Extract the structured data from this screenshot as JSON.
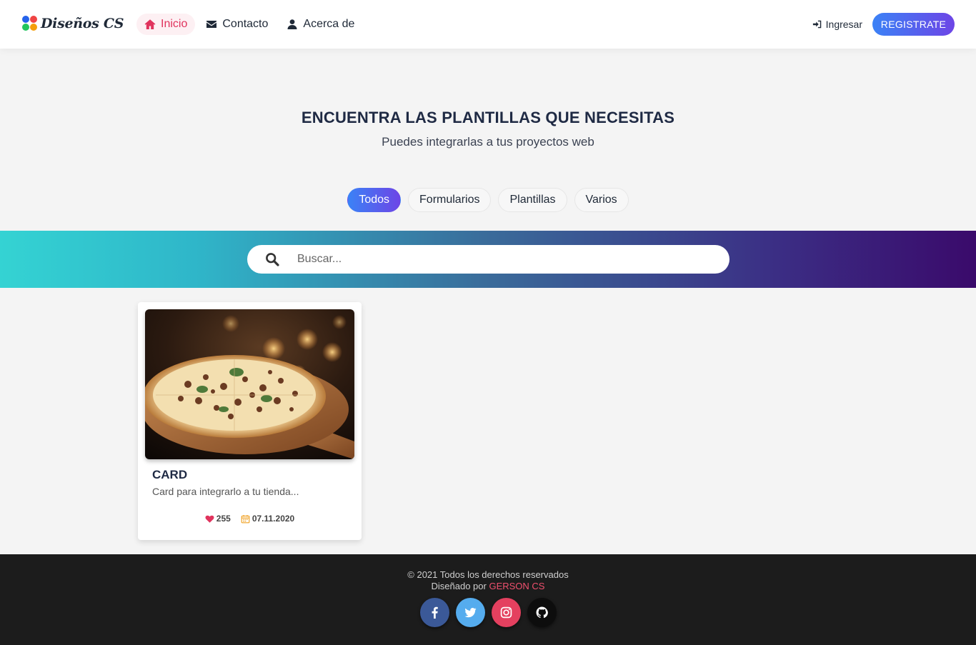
{
  "brand": {
    "name": "Diseños CS"
  },
  "nav": {
    "items": [
      {
        "label": "Inicio",
        "icon": "home-icon",
        "active": true
      },
      {
        "label": "Contacto",
        "icon": "envelope-icon",
        "active": false
      },
      {
        "label": "Acerca de",
        "icon": "user-icon",
        "active": false
      }
    ],
    "login_label": "Ingresar",
    "register_label": "REGISTRATE"
  },
  "hero": {
    "title": "ENCUENTRA LAS PLANTILLAS QUE NECESITAS",
    "subtitle": "Puedes integrarlas a tus proyectos web"
  },
  "filters": [
    {
      "label": "Todos",
      "active": true
    },
    {
      "label": "Formularios",
      "active": false
    },
    {
      "label": "Plantillas",
      "active": false
    },
    {
      "label": "Varios",
      "active": false
    }
  ],
  "search": {
    "placeholder": "Buscar...",
    "value": ""
  },
  "cards": [
    {
      "title": "CARD",
      "description": "Card para integrarlo a tu tienda...",
      "likes": "255",
      "date": "07.11.2020",
      "image": "pizza-image"
    }
  ],
  "footer": {
    "copyright": "© 2021 Todos los derechos reservados",
    "credit_prefix": "Diseñado por",
    "credit_name": "GERSON CS",
    "socials": [
      "facebook-icon",
      "twitter-icon",
      "instagram-icon",
      "github-icon"
    ]
  },
  "colors": {
    "accent": "#e0335d",
    "gradient_start": "#3b82f6",
    "gradient_end": "#6d45e6",
    "footer_bg": "#1c1c1c"
  }
}
